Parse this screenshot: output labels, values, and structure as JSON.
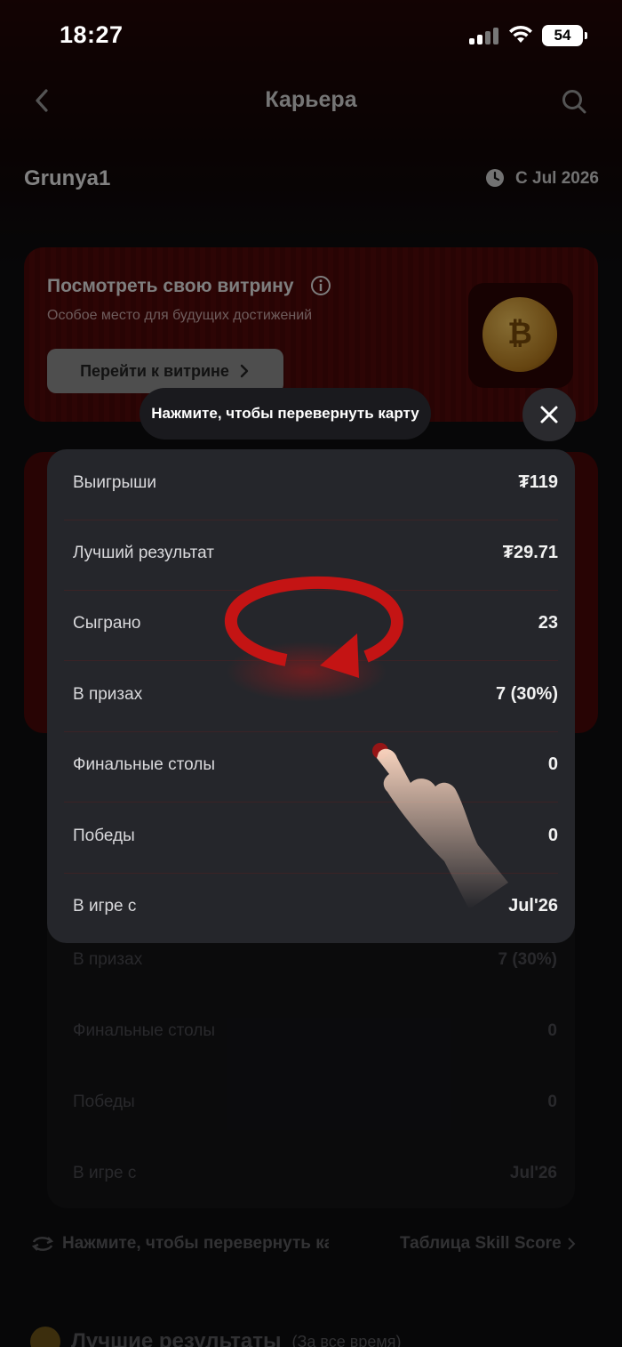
{
  "status_bar": {
    "time": "18:27",
    "battery": "54"
  },
  "header": {
    "title": "Карьера"
  },
  "profile": {
    "username": "Grunya1",
    "since": "С Jul 2026"
  },
  "showcase": {
    "title": "Посмотреть свою витрину",
    "subtitle": "Особое место для будущих достижений",
    "button_label": "Перейти к витрине",
    "coin_glyph": "₿"
  },
  "overlay": {
    "tooltip": "Нажмите, чтобы перевернуть карту"
  },
  "stats": [
    {
      "label": "Выигрыши",
      "value": "₮119"
    },
    {
      "label": "Лучший результат",
      "value": "₮29.71"
    },
    {
      "label": "Сыграно",
      "value": "23"
    },
    {
      "label": "В призах",
      "value": "7 (30%)"
    },
    {
      "label": "Финальные столы",
      "value": "0"
    },
    {
      "label": "Победы",
      "value": "0"
    },
    {
      "label": "В игре с",
      "value": "Jul'26"
    }
  ],
  "background_stats": [
    {
      "label": "В призах",
      "value": "7 (30%)"
    },
    {
      "label": "Финальные столы",
      "value": "0"
    },
    {
      "label": "Победы",
      "value": "0"
    },
    {
      "label": "В игре с",
      "value": "Jul'26"
    }
  ],
  "footer": {
    "flip_hint": "Нажмите, чтобы перевернуть ка",
    "skill_link": "Таблица Skill Score",
    "best_title": "Лучшие результаты",
    "best_period": "(За все время)"
  },
  "colors": {
    "accent_red": "#c41414",
    "card_bg": "#25262b",
    "showcase_bg": "#4a0808"
  }
}
